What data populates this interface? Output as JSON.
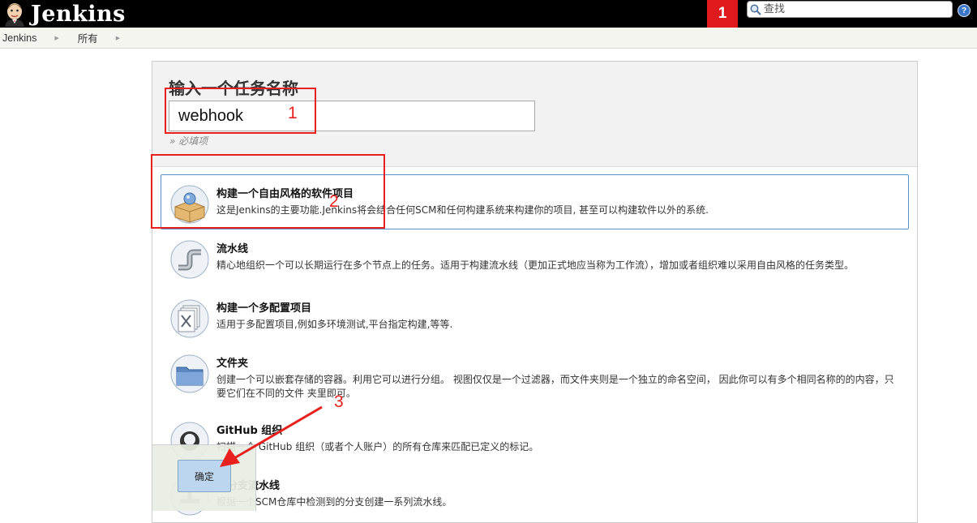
{
  "header": {
    "logo_text": "Jenkins",
    "notification_count": "1",
    "search_placeholder": "查找",
    "help_label": "?"
  },
  "breadcrumb": [
    "Jenkins",
    "所有"
  ],
  "form": {
    "title": "输入一个任务名称",
    "name_value": "webhook",
    "required_hint": "» 必填项"
  },
  "items": [
    {
      "name": "构建一个自由风格的软件项目",
      "desc": "这是Jenkins的主要功能.Jenkins将会结合任何SCM和任何构建系统来构建你的项目, 甚至可以构建软件以外的系统.",
      "icon": "freestyle-project-icon",
      "selected": true
    },
    {
      "name": "流水线",
      "desc": "精心地组织一个可以长期运行在多个节点上的任务。适用于构建流水线（更加正式地应当称为工作流），增加或者组织难以采用自由风格的任务类型。",
      "icon": "pipeline-icon"
    },
    {
      "name": "构建一个多配置项目",
      "desc": "适用于多配置项目,例如多环境测试,平台指定构建,等等.",
      "icon": "multi-config-project-icon"
    },
    {
      "name": "文件夹",
      "desc": "创建一个可以嵌套存储的容器。利用它可以进行分组。 视图仅仅是一个过滤器，而文件夹则是一个独立的命名空间， 因此你可以有多个相同名称的的内容，只要它们在不同的文件 夹里即可。",
      "icon": "folder-icon"
    },
    {
      "name": "GitHub 组织",
      "desc": "扫描一个 GitHub 组织（或者个人账户）的所有仓库来匹配已定义的标记。",
      "icon": "github-organization-icon"
    },
    {
      "name": "多分支流水线",
      "desc": "根据一个SCM仓库中检测到的分支创建一系列流水线。",
      "icon": "multibranch-pipeline-icon"
    }
  ],
  "ok_button": "确定",
  "annotations": [
    "1",
    "2",
    "3"
  ],
  "colors": {
    "annotation": "#e8211e",
    "header_bg": "#000000",
    "notification_bg": "#e0191f",
    "selected_border": "#5891c7"
  }
}
